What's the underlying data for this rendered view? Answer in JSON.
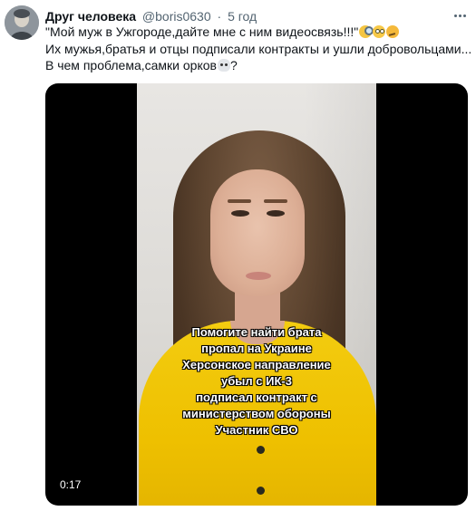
{
  "tweet": {
    "author_name": "Друг человека",
    "handle": "@boris0630",
    "separator": "·",
    "time": "5 год",
    "text_line1": "\"Мой муж в Ужгороде,дайте мне с ним видеосвязь!!!\"",
    "text_line2": "Их мужья,братья и отцы подписали контракты и ушли добровольцами...",
    "text_line3": "В чем проблема,самки орков",
    "text_line3_end": "?",
    "line1_emojis": [
      "magnifying-glass-icon",
      "rolling-eyes-icon",
      "thinking-face-icon"
    ],
    "line3_emoji": "skull-icon"
  },
  "video": {
    "caption_lines": [
      "Помогите найти брата",
      "пропал на Украине",
      "Херсонское направление",
      "убыл с ИК-3",
      "подписал контракт с",
      "министерством обороны",
      "Участник СВО"
    ],
    "timestamp": "0:17"
  },
  "colors": {
    "text": "#0f1419",
    "secondary": "#536471",
    "video_background": "#000000",
    "sweater": "#f3cc10"
  }
}
